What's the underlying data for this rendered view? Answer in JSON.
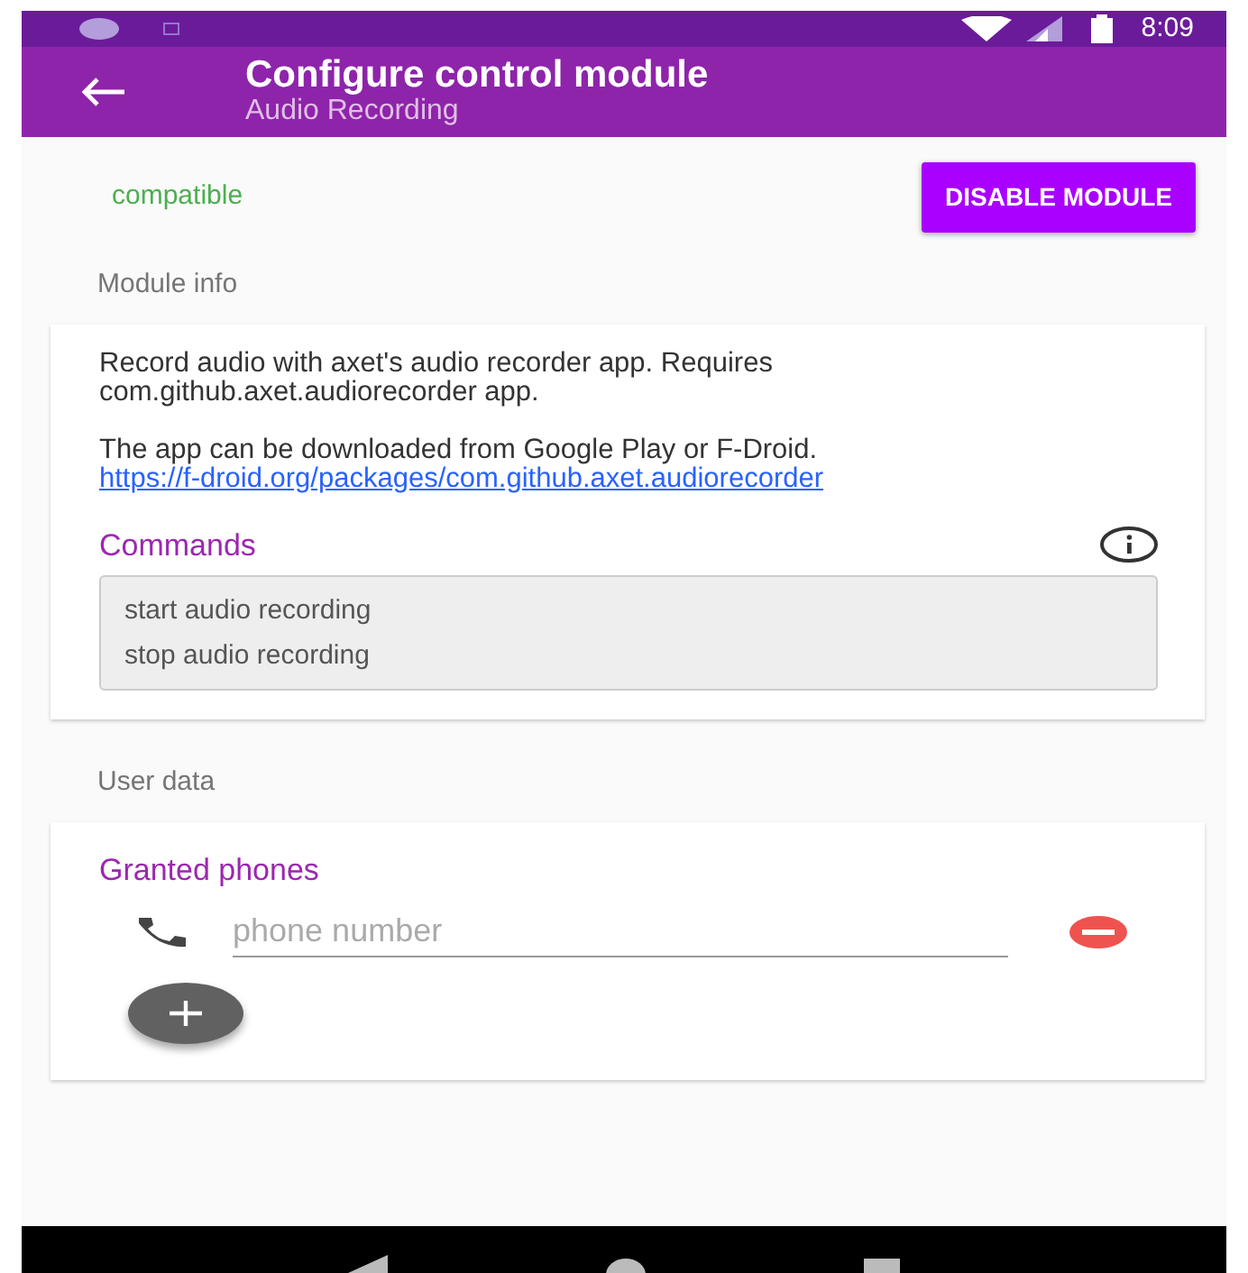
{
  "status_bar": {
    "time": "8:09"
  },
  "app_bar": {
    "title": "Configure control module",
    "subtitle": "Audio Recording"
  },
  "module": {
    "status": "compatible",
    "action_button": "DISABLE MODULE"
  },
  "module_info": {
    "heading": "Module info",
    "description": "Record audio with axet's audio recorder app. Requires com.github.axet.audiorecorder app.",
    "download_text": "The app can be downloaded from Google Play or F-Droid.",
    "download_link": "https://f-droid.org/packages/com.github.axet.audiorecorder",
    "commands_title": "Commands",
    "commands": [
      "start audio recording",
      "stop audio recording"
    ]
  },
  "user_data": {
    "heading": "User data",
    "granted_title": "Granted phones",
    "phones": [
      {
        "placeholder": "phone number"
      }
    ]
  }
}
